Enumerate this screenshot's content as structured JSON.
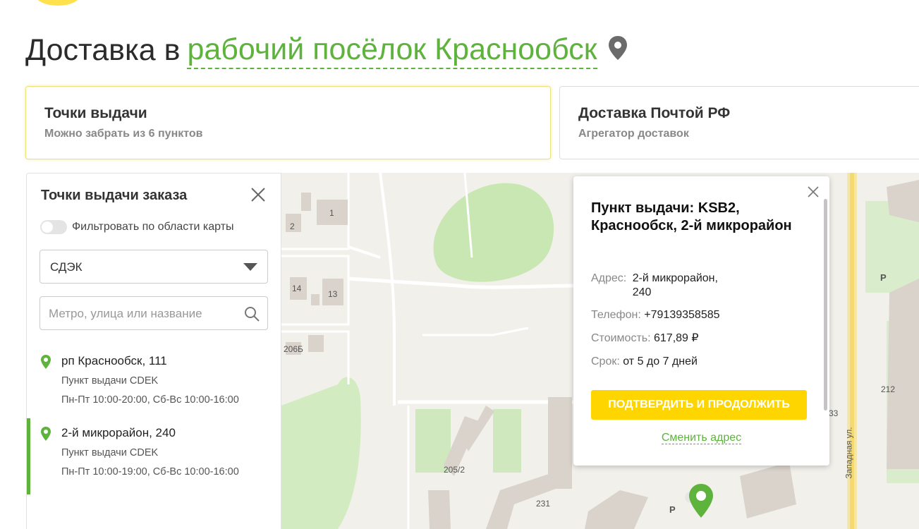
{
  "header": {
    "title_prefix": "Доставка в",
    "city": "рабочий посёлок Краснообск"
  },
  "tabs": [
    {
      "title": "Точки выдачи",
      "subtitle": "Можно забрать из 6 пунктов"
    },
    {
      "title": "Доставка Почтой РФ",
      "subtitle": "Агрегатор доставок"
    }
  ],
  "panel": {
    "title": "Точки выдачи заказа",
    "filter_label": "Фильтровать по области карты",
    "filter_on": false,
    "carrier_select": "СДЭК",
    "search_placeholder": "Метро, улица или название",
    "points": [
      {
        "address": "рп Краснообск, 111",
        "type": "Пункт выдачи CDEK",
        "hours": "Пн-Пт 10:00-20:00, Сб-Вс 10:00-16:00",
        "selected": false
      },
      {
        "address": "2-й микрорайон, 240",
        "type": "Пункт выдачи CDEK",
        "hours": "Пн-Пт 10:00-19:00, Сб-Вс 10:00-16:00",
        "selected": true
      }
    ]
  },
  "map": {
    "labels": {
      "l1": "1",
      "l2": "2",
      "l14": "14",
      "l13": "13",
      "l206": "206Б",
      "l205": "205/2",
      "l231": "231",
      "l212": "212",
      "l3": "33",
      "street": "Западная ул.",
      "parking": "P"
    }
  },
  "popup": {
    "title": "Пункт выдачи: KSB2, Краснообск, 2-й микрорайон",
    "address_label": "Адрес:",
    "address_value": "2-й микрорайон, 240",
    "phone_label": "Телефон:",
    "phone_value": "+79139358585",
    "cost_label": "Стоимость:",
    "cost_value": "617,89 ₽",
    "term_label": "Срок:",
    "term_value": "от 5 до 7 дней",
    "confirm_label": "ПОДТВЕРДИТЬ И ПРОДОЛЖИТЬ",
    "change_label": "Сменить адрес"
  },
  "colors": {
    "accent_green": "#5eb33c",
    "accent_yellow": "#ffd500"
  }
}
